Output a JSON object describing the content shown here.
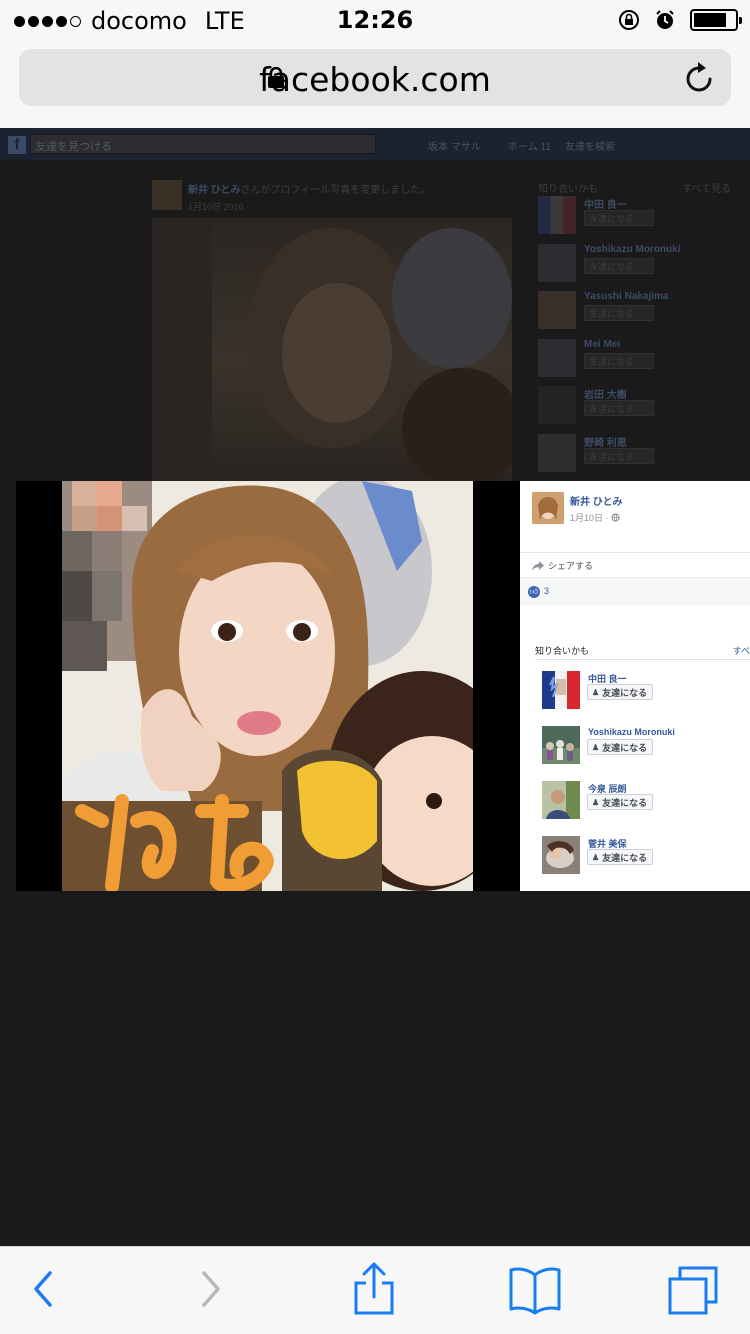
{
  "status_bar": {
    "carrier": "docomo",
    "network": "LTE",
    "time": "12:26",
    "signal_bars": 4,
    "signal_max": 5,
    "battery_level": 0.8,
    "icons": [
      "rotation-lock-icon",
      "alarm-icon",
      "battery-icon"
    ]
  },
  "browser": {
    "url": "facebook.com",
    "lock_icon": "lock-icon",
    "reload_icon": "reload-icon"
  },
  "background_page": {
    "search_placeholder": "友達を見つける",
    "nav": {
      "user": "坂本 マサル",
      "home": "ホーム 11",
      "find_friends": "友達を検索"
    },
    "post_author": "新井 ひとみ",
    "post_action": "さんがプロフィール写真を変更しました。",
    "post_date": "1月10日 2016 ·",
    "pymk_title": "知り合いかも",
    "pymk_all": "すべて見る",
    "people": [
      {
        "name": "中田 良一",
        "button": "友達になる"
      },
      {
        "name": "Yoshikazu Moronuki",
        "button": "友達になる"
      },
      {
        "name": "Yasushi Nakajima",
        "button": "友達になる"
      },
      {
        "name": "Mei Mei",
        "button": "友達になる"
      },
      {
        "name": "岩田 大樹",
        "button": "友達になる"
      },
      {
        "name": "野崎 利恵",
        "button": "友達になる"
      }
    ]
  },
  "lightbox": {
    "author": "新井 ひとみ",
    "date": "1月10日 ·",
    "share_label": "シェアする",
    "likes_count": "3",
    "pymk_title": "知り合いかも",
    "pymk_all": "すべ",
    "people": [
      {
        "name": "中田 良一",
        "button": "友達になる"
      },
      {
        "name": "Yoshikazu Moronuki",
        "button": "友達になる"
      },
      {
        "name": "今泉 辰朗",
        "button": "友達になる"
      },
      {
        "name": "菅井 美保",
        "button": "友達になる"
      }
    ]
  },
  "toolbar": {
    "back_icon": "back-arrow-icon",
    "forward_icon": "forward-arrow-icon",
    "share_icon": "share-icon",
    "bookmarks_icon": "bookmarks-icon",
    "tabs_icon": "tabs-icon"
  },
  "colors": {
    "fb_link": "#365899",
    "ios_blue": "#1a7cf2",
    "overlay_bg": "#151515"
  }
}
